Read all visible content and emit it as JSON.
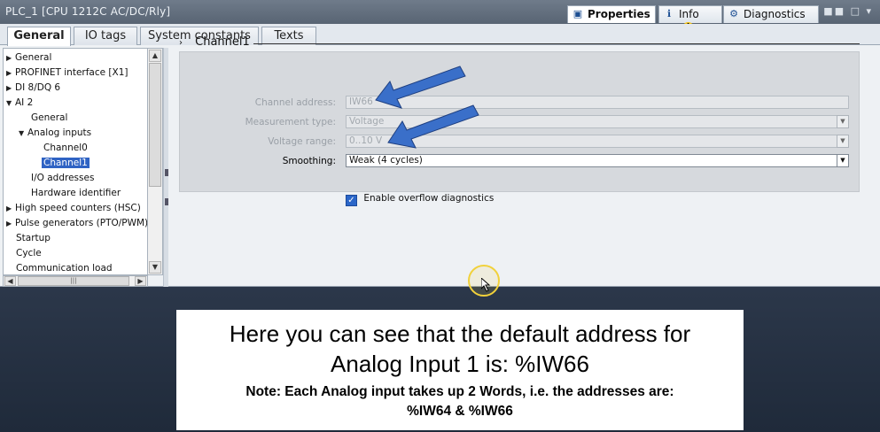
{
  "titlebar": {
    "title": "PLC_1 [CPU 1212C AC/DC/Rly]",
    "tabs": [
      {
        "label": "Properties",
        "icon": "properties-icon"
      },
      {
        "label": "Info",
        "icon": "info-icon",
        "badge": "i"
      },
      {
        "label": "Diagnostics",
        "icon": "diagnostics-icon"
      }
    ],
    "window_controls": "■■ □ ▾"
  },
  "tabs": [
    "General",
    "IO tags",
    "System constants",
    "Texts"
  ],
  "tree": [
    {
      "label": "General",
      "level": 0,
      "arrow": "▶"
    },
    {
      "label": "PROFINET interface [X1]",
      "level": 0,
      "arrow": "▶"
    },
    {
      "label": "DI 8/DQ 6",
      "level": 0,
      "arrow": "▶"
    },
    {
      "label": "AI 2",
      "level": 0,
      "arrow": "▼"
    },
    {
      "label": "General",
      "level": 1,
      "arrow": ""
    },
    {
      "label": "Analog inputs",
      "level": 1,
      "arrow": "▼"
    },
    {
      "label": "Channel0",
      "level": 2,
      "arrow": ""
    },
    {
      "label": "Channel1",
      "level": 2,
      "arrow": "",
      "selected": true
    },
    {
      "label": "I/O addresses",
      "level": 1,
      "arrow": ""
    },
    {
      "label": "Hardware identifier",
      "level": 1,
      "arrow": ""
    },
    {
      "label": "High speed counters (HSC)",
      "level": 0,
      "arrow": "▶"
    },
    {
      "label": "Pulse generators (PTO/PWM)",
      "level": 0,
      "arrow": "▶"
    },
    {
      "label": "Startup",
      "level": 0,
      "arrow": ""
    },
    {
      "label": "Cycle",
      "level": 0,
      "arrow": ""
    },
    {
      "label": "Communication load",
      "level": 0,
      "arrow": ""
    }
  ],
  "section": {
    "chevron": "›",
    "title": "Channel1"
  },
  "fields": {
    "channel_address": {
      "label": "Channel address:",
      "value": "IW66"
    },
    "measurement_type": {
      "label": "Measurement type:",
      "value": "Voltage"
    },
    "voltage_range": {
      "label": "Voltage range:",
      "value": "0..10 V"
    },
    "smoothing": {
      "label": "Smoothing:",
      "value": "Weak (4 cycles)"
    }
  },
  "overflow_diag": {
    "label": "Enable overflow diagnostics",
    "checked": true
  },
  "caption": {
    "line1": "Here you can see that the default address for",
    "line2": "Analog Input 1 is: %IW66",
    "line3": "Note: Each Analog input takes up 2 Words, i.e. the addresses are:",
    "line4": "%IW64 & %IW66"
  },
  "colors": {
    "accent": "#2f63c4",
    "annotation_arrow": "#3a6fc9",
    "cursor_ring": "#f1d13a"
  }
}
